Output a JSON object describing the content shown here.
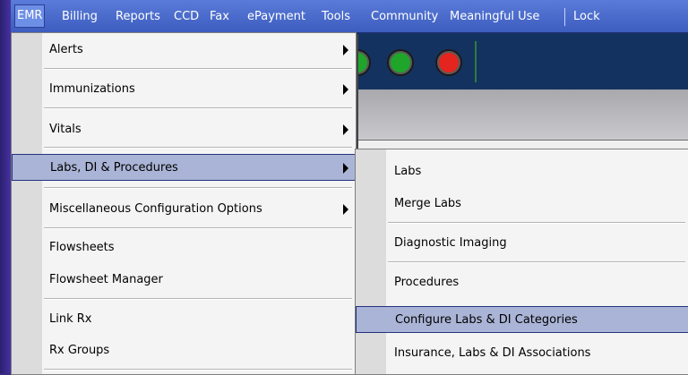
{
  "menubar": {
    "items": [
      {
        "label": "EMR",
        "active": true
      },
      {
        "label": "Billing"
      },
      {
        "label": "Reports"
      },
      {
        "label": "CCD"
      },
      {
        "label": "Fax"
      },
      {
        "label": "ePayment"
      },
      {
        "label": "Tools"
      },
      {
        "label": "Community"
      },
      {
        "label": "Meaningful Use"
      },
      {
        "label": "Lock"
      }
    ]
  },
  "toolbar": {
    "lights": [
      {
        "icon": "green-status-light-icon",
        "color": "#1fa52a"
      },
      {
        "icon": "green-status-light-icon",
        "color": "#1fa52a"
      },
      {
        "icon": "red-status-light-icon",
        "color": "#e3241f"
      }
    ]
  },
  "emr_menu": {
    "items": [
      {
        "label": "Alerts",
        "submenu": true
      },
      {
        "label": "Immunizations",
        "submenu": true
      },
      {
        "label": "Vitals",
        "submenu": true
      },
      {
        "label": "Labs, DI & Procedures",
        "submenu": true,
        "highlighted": true
      },
      {
        "label": "Miscellaneous Configuration Options",
        "submenu": true
      },
      {
        "label": "Flowsheets"
      },
      {
        "label": "Flowsheet Manager"
      },
      {
        "label": "Link Rx"
      },
      {
        "label": "Rx Groups"
      }
    ]
  },
  "labs_submenu": {
    "items": [
      {
        "label": "Labs"
      },
      {
        "label": "Merge Labs"
      },
      {
        "label": "Diagnostic Imaging"
      },
      {
        "label": "Procedures"
      },
      {
        "label": "Configure Labs & DI Categories",
        "highlighted": true
      },
      {
        "label": "Insurance, Labs & DI Associations"
      }
    ]
  },
  "colors": {
    "menubar": "#4a6ccc",
    "highlight": "#aab4d6",
    "background": "#3b2a86"
  }
}
